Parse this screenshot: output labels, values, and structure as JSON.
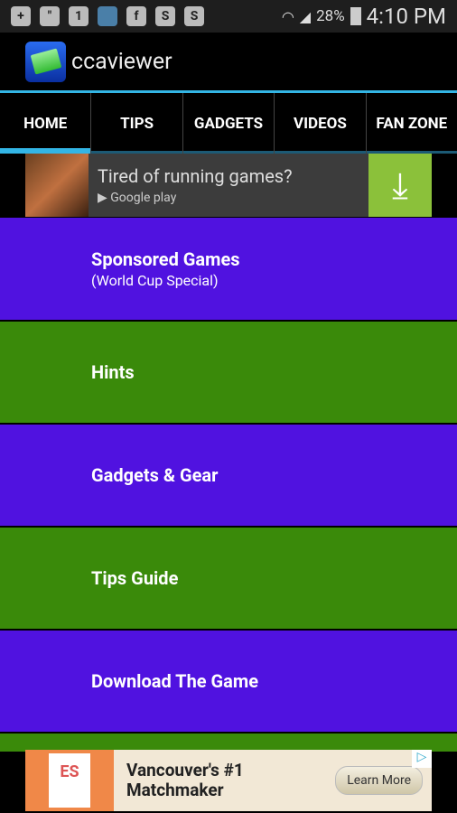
{
  "status_bar": {
    "icons": [
      "plus-icon",
      "hangouts-icon",
      "one-icon",
      "app-of-day-icon",
      "facebook-icon",
      "swype-icon",
      "skype-icon"
    ],
    "battery": "28%",
    "time": "4:10 PM"
  },
  "app": {
    "title": "ccaviewer"
  },
  "tabs": [
    {
      "label": "HOME",
      "active": true
    },
    {
      "label": "TIPS"
    },
    {
      "label": "GADGETS"
    },
    {
      "label": "VIDEOS"
    },
    {
      "label": "FAN ZONE"
    }
  ],
  "top_ad": {
    "headline": "Tired of running games?",
    "store": "Google play"
  },
  "menu": [
    {
      "label": "Sponsored Games",
      "sub": "(World Cup Special)",
      "color": "#5012e0"
    },
    {
      "label": "Hints",
      "color": "#3a8a0a"
    },
    {
      "label": "Gadgets & Gear",
      "color": "#5012e0"
    },
    {
      "label": "Tips Guide",
      "color": "#3a8a0a"
    },
    {
      "label": "Download The Game",
      "color": "#5012e0"
    }
  ],
  "bottom_ad": {
    "logo_text": "ES",
    "line1": "Vancouver's #1",
    "line2": "Matchmaker",
    "button": "Learn More"
  }
}
